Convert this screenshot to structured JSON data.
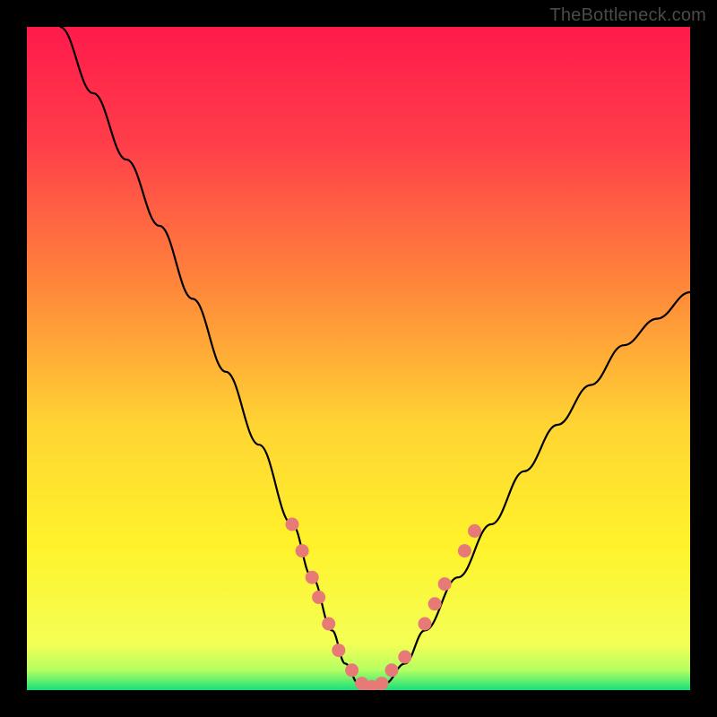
{
  "watermark": "TheBottleneck.com",
  "chart_data": {
    "type": "line",
    "title": "",
    "xlabel": "",
    "ylabel": "",
    "xlim": [
      0,
      100
    ],
    "ylim": [
      0,
      100
    ],
    "grid": false,
    "legend": false,
    "gradient_stops": [
      {
        "offset": 0.0,
        "color": "#ff1a4b"
      },
      {
        "offset": 0.18,
        "color": "#ff3f4a"
      },
      {
        "offset": 0.4,
        "color": "#ff8a3a"
      },
      {
        "offset": 0.6,
        "color": "#ffd433"
      },
      {
        "offset": 0.78,
        "color": "#fff22a"
      },
      {
        "offset": 0.93,
        "color": "#f4ff55"
      },
      {
        "offset": 0.97,
        "color": "#b4ff62"
      },
      {
        "offset": 1.0,
        "color": "#17e07a"
      }
    ],
    "curve": {
      "x": [
        5,
        10,
        15,
        20,
        25,
        30,
        35,
        40,
        43,
        46,
        48,
        50,
        52,
        54,
        57,
        60,
        65,
        70,
        75,
        80,
        85,
        90,
        95,
        100
      ],
      "y": [
        100,
        90,
        80,
        70,
        59,
        48,
        37,
        25,
        17,
        9,
        4,
        1,
        0,
        1,
        4,
        9,
        17,
        25,
        33,
        40,
        46,
        52,
        56,
        60
      ]
    },
    "markers": {
      "x": [
        40,
        41.5,
        43,
        44,
        45.5,
        47,
        49,
        50.5,
        52,
        53.5,
        55,
        57,
        60,
        61.5,
        63,
        66,
        67.5
      ],
      "y": [
        25,
        21,
        17,
        14,
        10,
        6,
        3,
        1,
        0.5,
        1,
        3,
        5,
        10,
        13,
        16,
        21,
        24
      ]
    },
    "marker_color": "#e77a77",
    "curve_color": "#000000"
  }
}
